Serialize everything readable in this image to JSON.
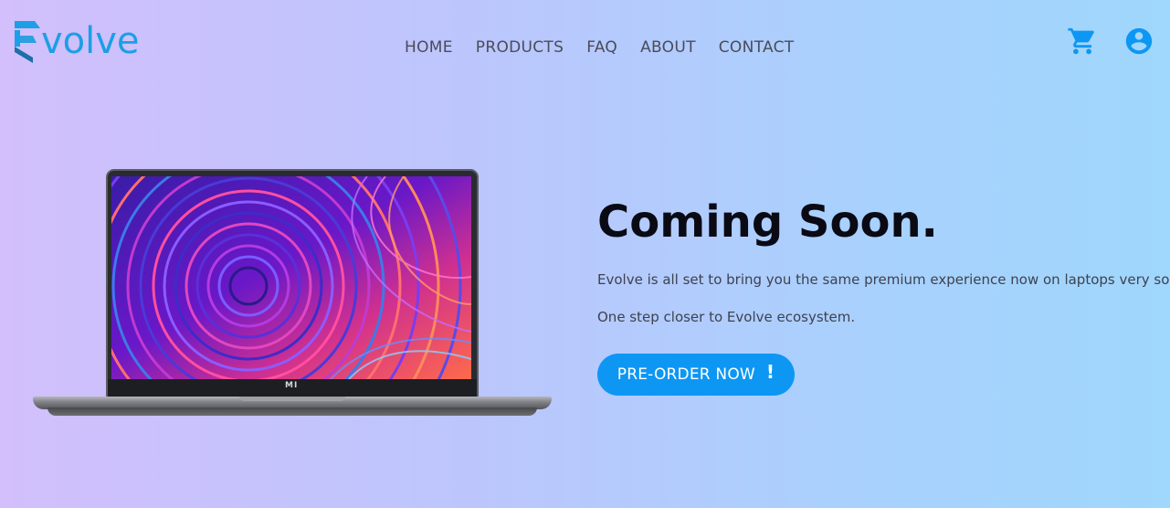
{
  "brand": {
    "name": "volve",
    "color": "#1c9fe6"
  },
  "nav": {
    "items": [
      {
        "label": "HOME"
      },
      {
        "label": "PRODUCTS"
      },
      {
        "label": "FAQ"
      },
      {
        "label": "ABOUT"
      },
      {
        "label": "CONTACT"
      }
    ]
  },
  "header_icons": {
    "cart": "cart-icon",
    "account": "account-circle-icon",
    "color": "#0d97f3"
  },
  "laptop": {
    "badge": "MI"
  },
  "hero": {
    "title": "Coming Soon.",
    "line1": "Evolve is all set to bring you the same premium experience now on laptops very soon.",
    "line2": "One step closer to Evolve ecosystem.",
    "cta_label": "PRE-ORDER NOW",
    "cta_suffix": "!",
    "cta_color": "#0d97f3"
  }
}
